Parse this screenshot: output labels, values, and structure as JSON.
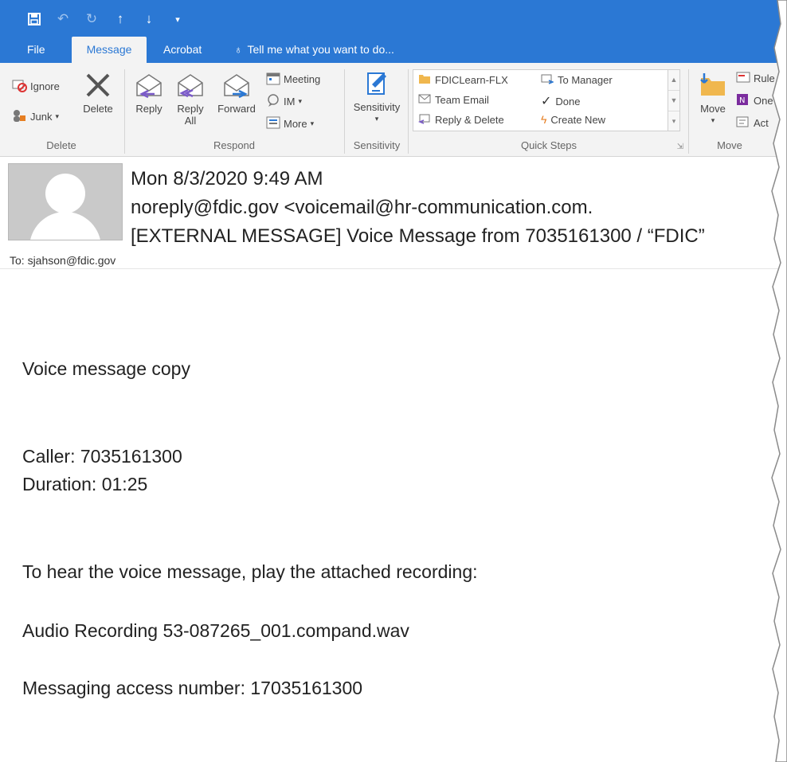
{
  "quick_access": {
    "icons": [
      "save-icon",
      "undo-icon",
      "redo-icon",
      "up-arrow-icon",
      "down-arrow-icon",
      "customize-icon"
    ]
  },
  "tabs": [
    {
      "label": "File"
    },
    {
      "label": "Message"
    },
    {
      "label": "Acrobat"
    },
    {
      "label": "Tell me what you want to do..."
    }
  ],
  "ribbon": {
    "delete_group": {
      "ignore": "Ignore",
      "junk": "Junk",
      "delete": "Delete",
      "label": "Delete"
    },
    "respond_group": {
      "reply": "Reply",
      "reply_all_1": "Reply",
      "reply_all_2": "All",
      "forward": "Forward",
      "meeting": "Meeting",
      "im": "IM",
      "more": "More",
      "label": "Respond"
    },
    "sensitivity_group": {
      "sensitivity": "Sensitivity",
      "label": "Sensitivity"
    },
    "quick_steps": {
      "items": [
        "FDICLearn-FLX",
        "To Manager",
        "Team Email",
        "Done",
        "Reply & Delete",
        "Create New"
      ],
      "label": "Quick Steps"
    },
    "move_group": {
      "move": "Move",
      "rules": "Rule",
      "onenote": "One",
      "actions": "Act",
      "label": "Move"
    }
  },
  "message": {
    "date": "Mon 8/3/2020 9:49 AM",
    "from": "noreply@fdic.gov  <voicemail@hr-communication.com.",
    "subject": "[EXTERNAL MESSAGE]  Voice Message from 7035161300 / “FDIC”",
    "to": "To: sjahson@fdic.gov"
  },
  "body": {
    "line1": "Voice message copy",
    "caller": "Caller: 7035161300",
    "duration": "Duration: 01:25",
    "instruction": "To hear the voice message, play the attached recording:",
    "attachment": "Audio Recording 53-087265_001.compand.wav",
    "access": "Messaging access number: 17035161300"
  },
  "colors": {
    "accent": "#2b78d4",
    "ribbon_bg": "#f3f3f3"
  }
}
